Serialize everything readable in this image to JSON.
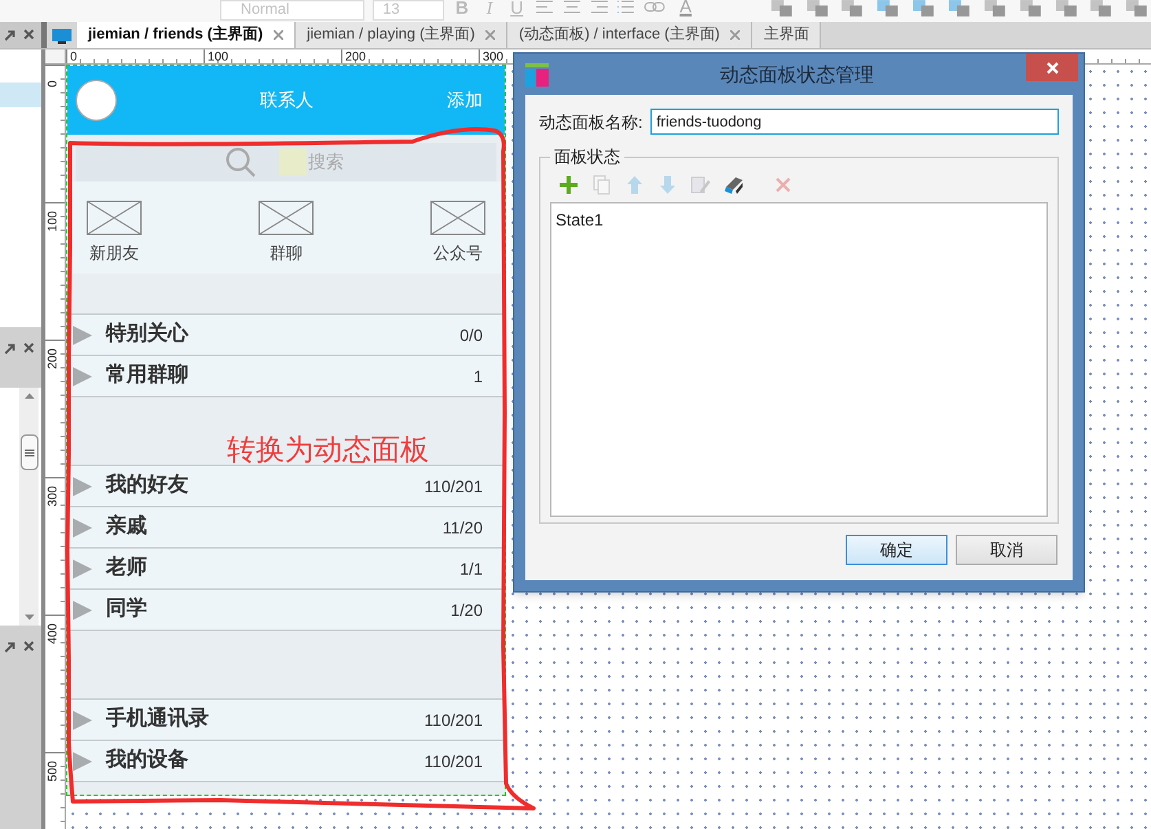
{
  "toolbar": {
    "style_value": "Normal",
    "size_value": "13",
    "format_buttons": [
      "B",
      "I",
      "U"
    ],
    "color_letter": "A"
  },
  "tabs": [
    {
      "label": "jiemian / friends (主界面)",
      "selected": true,
      "closable": true
    },
    {
      "label": "jiemian / playing (主界面)",
      "selected": false,
      "closable": true
    },
    {
      "label": "(动态面板) / interface (主界面)",
      "selected": false,
      "closable": true
    },
    {
      "label": "主界面",
      "selected": false,
      "closable": false
    }
  ],
  "rulers": {
    "horizontal": [
      "0",
      "100",
      "200",
      "300"
    ],
    "vertical": [
      "0",
      "100",
      "200",
      "300",
      "400",
      "500"
    ]
  },
  "prototype": {
    "header": {
      "title": "联系人",
      "action": "添加"
    },
    "search": {
      "placeholder": "搜索"
    },
    "shortcuts": [
      {
        "label": "新朋友"
      },
      {
        "label": "群聊"
      },
      {
        "label": "公众号"
      }
    ],
    "sections": [
      [
        {
          "name": "特别关心",
          "count": "0/0"
        },
        {
          "name": "常用群聊",
          "count": "1"
        }
      ],
      [
        {
          "name": "我的好友",
          "count": "110/201"
        },
        {
          "name": "亲戚",
          "count": "11/20"
        },
        {
          "name": "老师",
          "count": "1/1"
        },
        {
          "name": "同学",
          "count": "1/20"
        }
      ],
      [
        {
          "name": "手机通讯录",
          "count": "110/201"
        },
        {
          "name": "我的设备",
          "count": "110/201"
        }
      ]
    ]
  },
  "annotation": {
    "text": "转换为动态面板"
  },
  "dialog": {
    "title": "动态面板状态管理",
    "name_label": "动态面板名称:",
    "name_value": "friends-tuodong",
    "group_label": "面板状态",
    "tools": [
      {
        "kind": "add",
        "disabled": false
      },
      {
        "kind": "duplicate",
        "disabled": true
      },
      {
        "kind": "up",
        "disabled": true
      },
      {
        "kind": "down",
        "disabled": true
      },
      {
        "kind": "edit",
        "disabled": true
      },
      {
        "kind": "edit_all",
        "disabled": false
      },
      {
        "kind": "delete",
        "disabled": true
      }
    ],
    "states": [
      {
        "label": "State1"
      }
    ],
    "buttons": [
      {
        "label": "确定",
        "default": true
      },
      {
        "label": "取消",
        "default": false
      }
    ]
  }
}
